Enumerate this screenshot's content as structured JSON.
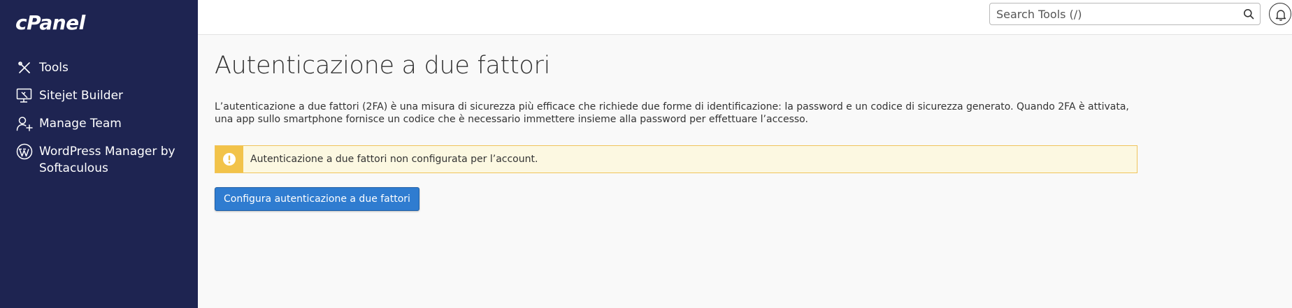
{
  "brand": {
    "logo_text": "cPanel"
  },
  "sidebar": {
    "items": [
      {
        "label": "Tools",
        "icon": "tools-icon"
      },
      {
        "label": "Sitejet Builder",
        "icon": "sitejet-icon"
      },
      {
        "label": "Manage Team",
        "icon": "manage-team-icon"
      },
      {
        "label": "WordPress Manager by Softaculous",
        "icon": "wordpress-icon"
      }
    ]
  },
  "header": {
    "search": {
      "placeholder": "Search Tools (/)",
      "value": ""
    },
    "icons": [
      "search-icon",
      "bell-icon"
    ]
  },
  "main": {
    "title": "Autenticazione a due fattori",
    "description": "L’autenticazione a due fattori (2FA) è una misura di sicurezza più efficace che richiede due forme di identificazione: la password e un codice di sicurezza generato. Quando 2FA è attivata, una app sullo smartphone fornisce un codice che è necessario immettere insieme alla password per effettuare l’accesso.",
    "alert": {
      "icon": "warning-icon",
      "text": "Autenticazione a due fattori non configurata per l’account."
    },
    "configure_button": "Configura autenticazione a due fattori"
  },
  "colors": {
    "sidebar_bg": "#1e2451",
    "page_bg": "#f9f9f9",
    "alert_bg": "#fcf8e1",
    "alert_accent": "#f2c34a",
    "primary": "#2f7cd0"
  }
}
